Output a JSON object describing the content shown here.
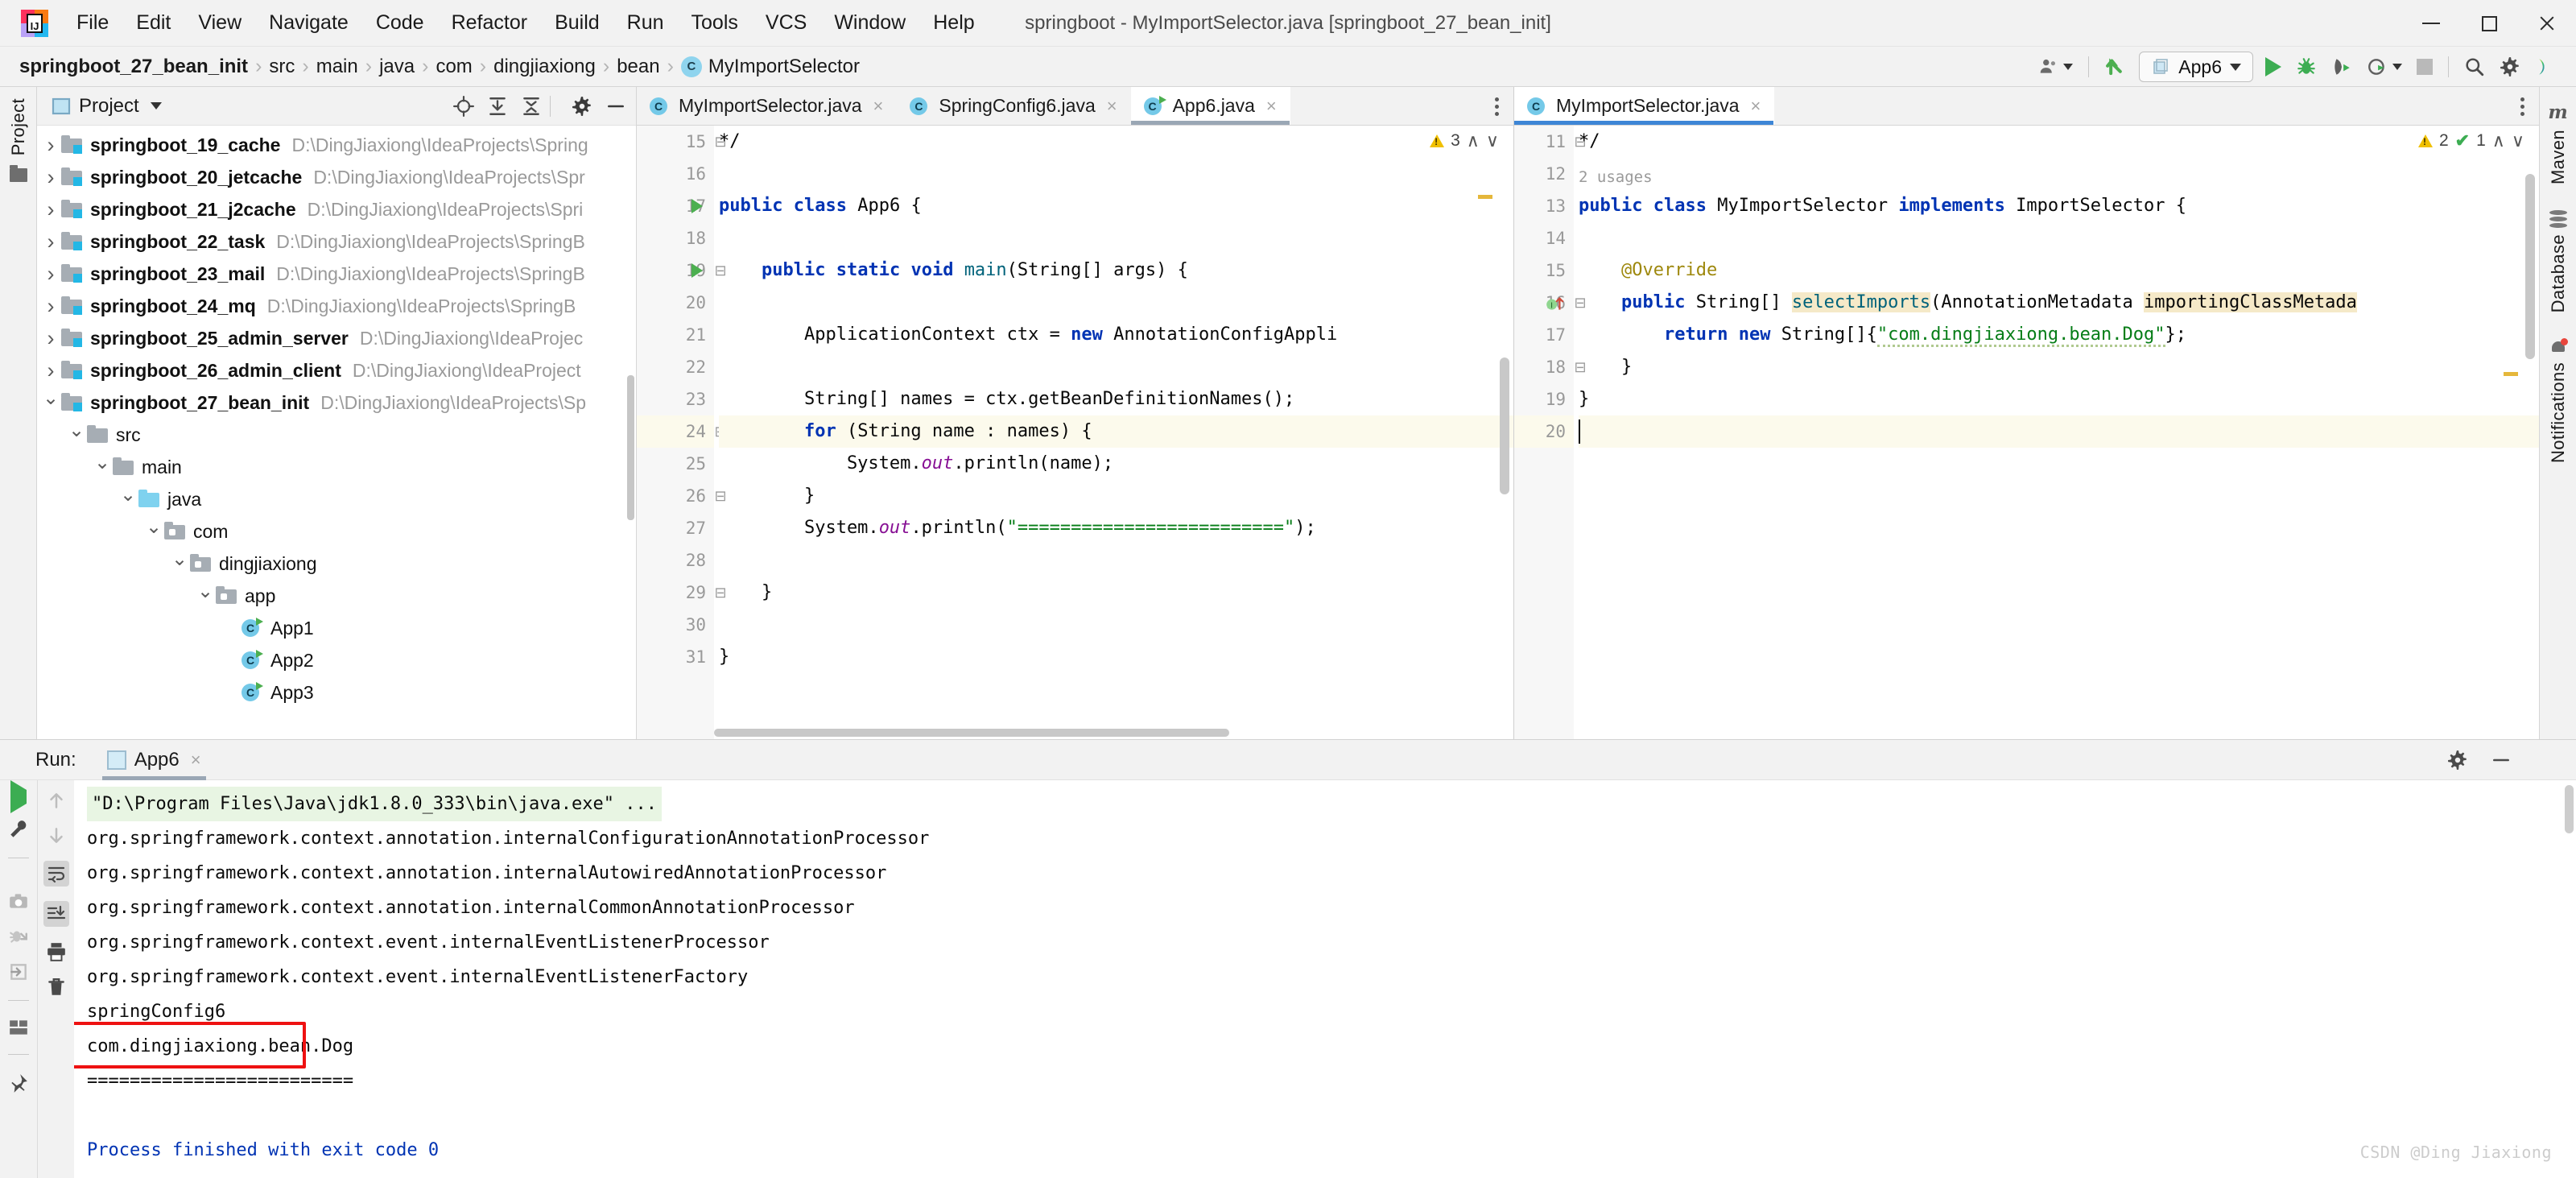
{
  "window": {
    "title": "springboot - MyImportSelector.java [springboot_27_bean_init]",
    "minimize_label": "Minimize",
    "maximize_label": "Maximize",
    "close_label": "Close"
  },
  "menu": [
    {
      "label": "File"
    },
    {
      "label": "Edit"
    },
    {
      "label": "View"
    },
    {
      "label": "Navigate"
    },
    {
      "label": "Code"
    },
    {
      "label": "Refactor"
    },
    {
      "label": "Build"
    },
    {
      "label": "Run"
    },
    {
      "label": "Tools"
    },
    {
      "label": "VCS"
    },
    {
      "label": "Window"
    },
    {
      "label": "Help"
    }
  ],
  "breadcrumb": {
    "items": [
      "springboot_27_bean_init",
      "src",
      "main",
      "java",
      "com",
      "dingjiaxiong",
      "bean"
    ],
    "class_badge": "C",
    "class_name": "MyImportSelector"
  },
  "nav_toolbar": {
    "run_config": "App6",
    "icons": [
      "user-icon",
      "updates-icon",
      "run-icon",
      "debug-icon",
      "run-with-coverage-icon",
      "profile-icon",
      "stop-icon",
      "search-everywhere-icon",
      "settings-icon",
      "ide-help-icon"
    ]
  },
  "left_strip": {
    "project_label": "Project",
    "structure_icon": "folder-icon"
  },
  "project_panel": {
    "title": "Project",
    "toolbar_icons": [
      "locate-icon",
      "expand-all-icon",
      "collapse-all-icon",
      "gear-icon",
      "hide-icon"
    ],
    "tree": [
      {
        "indent": 0,
        "chev": "right",
        "icon": "module-folder",
        "name": "springboot_19_cache",
        "path": "D:\\DingJiaxiong\\IdeaProjects\\Spring"
      },
      {
        "indent": 0,
        "chev": "right",
        "icon": "module-folder",
        "name": "springboot_20_jetcache",
        "path": "D:\\DingJiaxiong\\IdeaProjects\\Spr"
      },
      {
        "indent": 0,
        "chev": "right",
        "icon": "module-folder",
        "name": "springboot_21_j2cache",
        "path": "D:\\DingJiaxiong\\IdeaProjects\\Spri"
      },
      {
        "indent": 0,
        "chev": "right",
        "icon": "module-folder",
        "name": "springboot_22_task",
        "path": "D:\\DingJiaxiong\\IdeaProjects\\SpringB"
      },
      {
        "indent": 0,
        "chev": "right",
        "icon": "module-folder",
        "name": "springboot_23_mail",
        "path": "D:\\DingJiaxiong\\IdeaProjects\\SpringB"
      },
      {
        "indent": 0,
        "chev": "right",
        "icon": "module-folder",
        "name": "springboot_24_mq",
        "path": "D:\\DingJiaxiong\\IdeaProjects\\SpringB"
      },
      {
        "indent": 0,
        "chev": "right",
        "icon": "module-folder",
        "name": "springboot_25_admin_server",
        "path": "D:\\DingJiaxiong\\IdeaProjec"
      },
      {
        "indent": 0,
        "chev": "right",
        "icon": "module-folder",
        "name": "springboot_26_admin_client",
        "path": "D:\\DingJiaxiong\\IdeaProject"
      },
      {
        "indent": 0,
        "chev": "down",
        "icon": "module-folder",
        "name": "springboot_27_bean_init",
        "path": "D:\\DingJiaxiong\\IdeaProjects\\Sp"
      },
      {
        "indent": 1,
        "chev": "down",
        "icon": "plain-folder",
        "name": "src",
        "path": ""
      },
      {
        "indent": 2,
        "chev": "down",
        "icon": "plain-folder",
        "name": "main",
        "path": ""
      },
      {
        "indent": 3,
        "chev": "down",
        "icon": "source-folder",
        "name": "java",
        "path": ""
      },
      {
        "indent": 4,
        "chev": "down",
        "icon": "package-folder",
        "name": "com",
        "path": ""
      },
      {
        "indent": 5,
        "chev": "down",
        "icon": "package-folder",
        "name": "dingjiaxiong",
        "path": ""
      },
      {
        "indent": 6,
        "chev": "down",
        "icon": "package-folder",
        "name": "app",
        "path": ""
      },
      {
        "indent": 7,
        "chev": "none",
        "icon": "java-runnable",
        "name": "App1",
        "path": ""
      },
      {
        "indent": 7,
        "chev": "none",
        "icon": "java-runnable",
        "name": "App2",
        "path": ""
      },
      {
        "indent": 7,
        "chev": "none",
        "icon": "java-runnable",
        "name": "App3",
        "path": ""
      }
    ]
  },
  "editor_left": {
    "tabs": [
      {
        "label": "MyImportSelector.java",
        "icon": "class-icon",
        "active": false,
        "runnable": false
      },
      {
        "label": "SpringConfig6.java",
        "icon": "class-icon",
        "active": false,
        "runnable": false
      },
      {
        "label": "App6.java",
        "icon": "class-icon",
        "active": true,
        "runnable": true
      }
    ],
    "close_glyph": "×",
    "inspection": {
      "warnings": "3",
      "up": "∧",
      "down": "∨"
    },
    "lines": [
      {
        "n": "15",
        "text": "*/",
        "fold": "end"
      },
      {
        "n": "16",
        "text": ""
      },
      {
        "n": "17",
        "text": "public class App6 {",
        "run": true
      },
      {
        "n": "18",
        "text": ""
      },
      {
        "n": "19",
        "text": "    public static void main(String[] args) {",
        "run": true,
        "fold": "start"
      },
      {
        "n": "20",
        "text": ""
      },
      {
        "n": "21",
        "text": "        ApplicationContext ctx = new AnnotationConfigAppli"
      },
      {
        "n": "22",
        "text": ""
      },
      {
        "n": "23",
        "text": "        String[] names = ctx.getBeanDefinitionNames();"
      },
      {
        "n": "24",
        "text": "        for (String name : names) {",
        "highlight": true,
        "fold": "start"
      },
      {
        "n": "25",
        "text": "            System.out.println(name);"
      },
      {
        "n": "26",
        "text": "        }",
        "fold": "end"
      },
      {
        "n": "27",
        "text": "        System.out.println(\"=========================\");"
      },
      {
        "n": "28",
        "text": ""
      },
      {
        "n": "29",
        "text": "    }",
        "fold": "end"
      },
      {
        "n": "30",
        "text": ""
      },
      {
        "n": "31",
        "text": "}"
      }
    ]
  },
  "editor_right": {
    "tabs": [
      {
        "label": "MyImportSelector.java",
        "icon": "class-icon",
        "active": true,
        "runnable": false
      }
    ],
    "close_glyph": "×",
    "inspection": {
      "warnings": "2",
      "checks": "1",
      "up": "∧",
      "down": "∨"
    },
    "usages_hint": "2 usages",
    "lines": [
      {
        "n": "11",
        "text": "*/",
        "fold": "end"
      },
      {
        "n": "12",
        "text": ""
      },
      {
        "n": "13",
        "text": "public class MyImportSelector implements ImportSelector {"
      },
      {
        "n": "14",
        "text": ""
      },
      {
        "n": "15",
        "text": "    @Override"
      },
      {
        "n": "16",
        "text": "    public String[] selectImports(AnnotationMetadata importingClassMetada",
        "impl": true,
        "fold": "start"
      },
      {
        "n": "17",
        "text": "        return new String[]{\"com.dingjiaxiong.bean.Dog\"};"
      },
      {
        "n": "18",
        "text": "    }",
        "fold": "end"
      },
      {
        "n": "19",
        "text": "}"
      },
      {
        "n": "20",
        "text": "",
        "caret": true,
        "highlight": true
      }
    ]
  },
  "right_strip": {
    "items": [
      {
        "label": "Maven",
        "icon": "maven-icon"
      },
      {
        "label": "Database",
        "icon": "database-icon"
      },
      {
        "label": "Notifications",
        "icon": "bell-icon"
      }
    ]
  },
  "run_panel": {
    "label": "Run:",
    "tab": "App6",
    "tab_close": "×",
    "settings_icon": "gear-icon",
    "hide_icon": "hide-icon",
    "left_tools": [
      "rerun-icon",
      "edit-configurations-icon",
      "stop-icon",
      "screenshot-icon",
      "dump-threads-icon",
      "export-icon",
      "layout-icon",
      "pin-icon"
    ],
    "right_tools": [
      "up-icon",
      "down-icon",
      "soft-wrap-icon",
      "scroll-to-end-icon",
      "print-icon",
      "clear-all-icon"
    ],
    "console": [
      {
        "text": "\"D:\\Program Files\\Java\\jdk1.8.0_333\\bin\\java.exe\" ...",
        "style": "cmd"
      },
      {
        "text": "org.springframework.context.annotation.internalConfigurationAnnotationProcessor",
        "style": "normal"
      },
      {
        "text": "org.springframework.context.annotation.internalAutowiredAnnotationProcessor",
        "style": "normal"
      },
      {
        "text": "org.springframework.context.annotation.internalCommonAnnotationProcessor",
        "style": "normal"
      },
      {
        "text": "org.springframework.context.event.internalEventListenerProcessor",
        "style": "normal"
      },
      {
        "text": "org.springframework.context.event.internalEventListenerFactory",
        "style": "normal"
      },
      {
        "text": "springConfig6",
        "style": "normal"
      },
      {
        "text": "com.dingjiaxiong.bean.Dog",
        "style": "normal",
        "boxed": true
      },
      {
        "text": "=========================",
        "style": "normal"
      },
      {
        "text": "",
        "style": "normal"
      },
      {
        "text": "Process finished with exit code 0",
        "style": "exit"
      }
    ],
    "highlight_box_color": "#ee1111"
  },
  "watermark": "CSDN @Ding Jiaxiong",
  "colors": {
    "accent_blue": "#3e86d6",
    "keyword": "#0033b3",
    "string": "#067d17",
    "annotation": "#9e880d",
    "method": "#00627a",
    "static_field": "#871094",
    "red_box": "#ee1111"
  }
}
